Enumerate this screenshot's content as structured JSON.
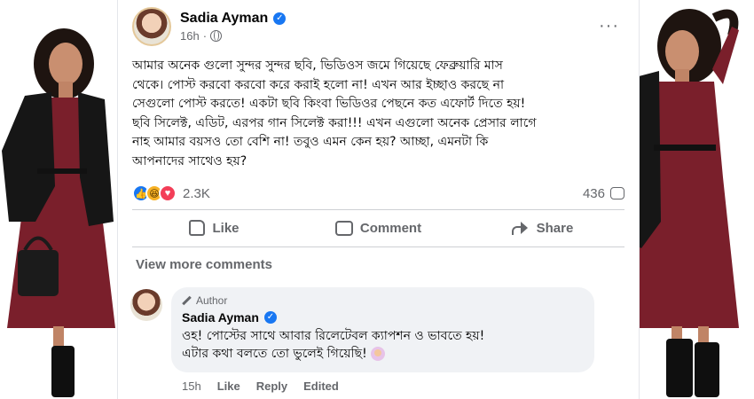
{
  "post": {
    "author": "Sadia Ayman",
    "time": "16h",
    "more_label": "···",
    "text": "আমার অনেক গুলো সুন্দর সুন্দর ছবি, ভিডিওস জমে গিয়েছে ফেব্রুয়ারি মাস\nথেকে। পোস্ট করবো করবো করে করাই হলো না! এখন আর ইচ্ছাও করছে না\nসেগুলো পোস্ট করতে! একটা ছবি কিংবা ভিডিওর পেছনে কত এফোর্ট দিতে হয়!\nছবি সিলেক্ট, এডিট, এরপর গান সিলেক্ট করা!!! এখন এগুলো অনেক প্রেসার লাগে\nনাহ আমার বয়সও তো বেশি না! তবুও এমন কেন হয়? আচ্ছা, এমনটা কি\nআপনাদের সাথেও হয়?"
  },
  "stats": {
    "reactions": "2.3K",
    "comments": "436",
    "reaction_types": [
      "like",
      "haha",
      "love"
    ]
  },
  "actions": {
    "like": "Like",
    "comment": "Comment",
    "share": "Share"
  },
  "view_more_comments": "View more comments",
  "comment": {
    "badge": "Author",
    "author": "Sadia Ayman",
    "text": "ওহ! পোস্টের সাথে আবার রিলেটেবল ক্যাপশন ও ভাবতে হয়!\nএটার কথা বলতে তো ভুলেই গিয়েছি!",
    "time": "15h",
    "like": "Like",
    "reply": "Reply",
    "edited": "Edited"
  },
  "colors": {
    "accent": "#1877f2",
    "dress": "#7a1f2b",
    "jacket": "#1a1a1a"
  }
}
